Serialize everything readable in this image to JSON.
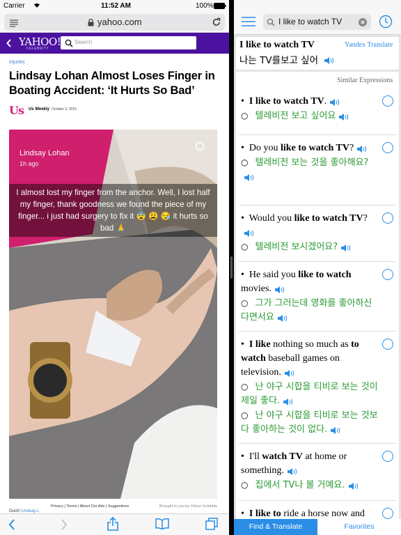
{
  "status": {
    "carrier": "Carrier",
    "time": "11:52 AM",
    "battery": "100%"
  },
  "browser": {
    "url": "yahoo.com"
  },
  "yahoo": {
    "logo": "YAHOO!",
    "logo_sub": "CELEBRITY",
    "search_placeholder": "Search"
  },
  "article": {
    "category": "Injuries",
    "headline": "Lindsay Lohan Almost Loses Finger in Boating Accident: ‘It Hurts So Bad’",
    "source_logo": "Us",
    "source_name": "Us Weekly",
    "date": "October 3, 2016",
    "snap_name": "Lindsay Lohan",
    "snap_time": "1h ago",
    "caption": "I almost lost my finger from the anchor. Well, I lost half my finger, thank goodness we found the piece of my finger... i just had surgery to fix it 😨 😩 😪 it hurts so bad 🙏",
    "footer_links": [
      "Privacy",
      "Terms",
      "About Our Ads",
      "Suggestions"
    ],
    "footer_credit": "Brought to you by Yahoo Celebrity",
    "quote_prefix": "Ouch! ",
    "quote_link": "Lindsay L"
  },
  "translator": {
    "query": "I like to watch TV",
    "provider": "Yandex Translate",
    "result_en": "I like to watch TV",
    "result_ko": "나는 TV를보고 싶어",
    "similar_title": "Similar Expressions",
    "items": [
      {
        "en_html": "<b>I like to watch TV</b>.",
        "ko": [
          "텔레비전 보고 싶어요"
        ]
      },
      {
        "en_html": "Do you <b>like to watch TV</b>?",
        "ko": [
          "텔레비전 보는 것을 좋아해요?"
        ]
      },
      {
        "en_html": "Would you <b>like to watch TV</b>?",
        "ko": [
          "텔레비전 보시겠어요?"
        ]
      },
      {
        "en_html": "He said you <b>like to watch</b> movies.",
        "ko": [
          "그가 그러는데 영화를 좋아하신다면서요"
        ]
      },
      {
        "en_html": "<b>I like</b> nothing so much as <b>to watch</b> baseball games on television.",
        "ko": [
          "난 야구 시합을 티비로 보는 것이 제일 좋다.",
          "난 야구 시합을 티비로 보는 것보다 좋아하는 것이 없다."
        ]
      },
      {
        "en_html": "I'll <b>watch TV</b> at home or something.",
        "ko": [
          "집에서 TV나 볼 거예요."
        ]
      },
      {
        "en_html": "<b>I like to</b> ride a horse now and",
        "ko": []
      }
    ],
    "tabs": {
      "find": "Find & Translate",
      "favorites": "Favorites"
    }
  },
  "colors": {
    "yahoo_purple": "#4b12a0",
    "accent_blue": "#2a8ee6",
    "korean_green": "#2b9a33",
    "tab_active": "#2a8ee6"
  }
}
